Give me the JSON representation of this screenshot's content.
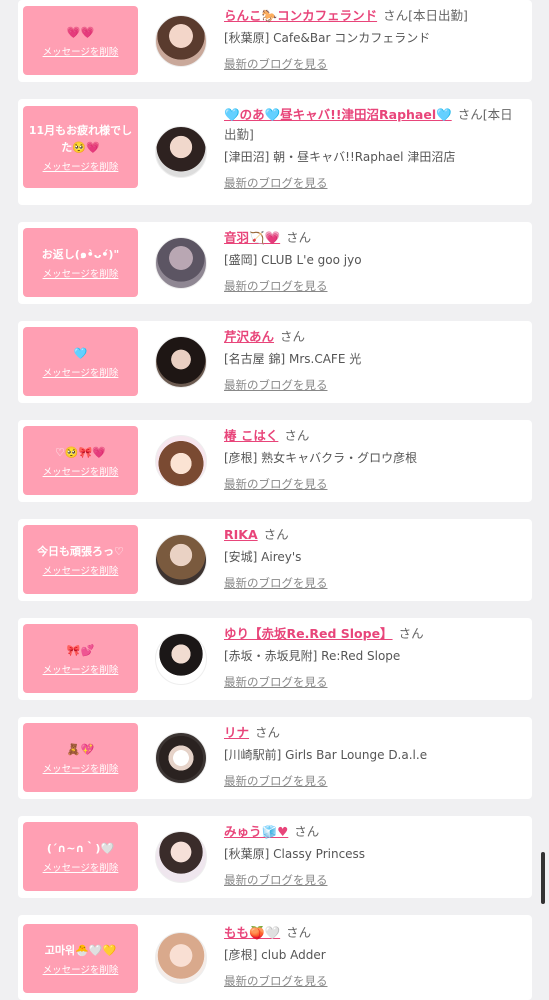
{
  "common": {
    "delete_label": "メッセージを削除",
    "blog_label": "最新のブログを見る"
  },
  "items": [
    {
      "message": "💗💗",
      "name": "らんこ🐎コンカフェランド",
      "suffix": "さん[本日出勤]",
      "shop": "[秋葉原] Cafe&Bar コンカフェランド"
    },
    {
      "message": "11月もお疲れ様でした🥺💗",
      "name": "🩵のあ🩵昼キャバ!!津田沼Raphael🩵",
      "suffix": "さん[本日出勤]",
      "shop": "[津田沼] 朝・昼キャバ!!Raphael 津田沼店"
    },
    {
      "message": "お返し(๑•̀ᴗ•́)\"",
      "name": "音羽🏹💗",
      "suffix": "さん",
      "shop": "[盛岡] CLUB L'e goo jyo"
    },
    {
      "message": "🩵",
      "name": "芹沢あん",
      "suffix": "さん",
      "shop": "[名古屋 錦] Mrs.CAFE 光"
    },
    {
      "message": "♡🥺🎀💗",
      "name": "椿 こはく",
      "suffix": "さん",
      "shop": "[彦根] 熟女キャバクラ・グロウ彦根"
    },
    {
      "message": "今日も頑張ろっ♡",
      "name": "RIKA",
      "suffix": "さん",
      "shop": "[安城] Airey's"
    },
    {
      "message": "🎀💕",
      "name": "ゆり【赤坂Re.Red Slope】",
      "suffix": "さん",
      "shop": "[赤坂・赤坂見附] Re:Red Slope"
    },
    {
      "message": "🧸💖",
      "name": "リナ",
      "suffix": "さん",
      "shop": "[川崎駅前] Girls Bar Lounge D.a.l.e"
    },
    {
      "message": "(´∩~∩｀)🤍",
      "name": "みゅう🧊♥",
      "suffix": "さん",
      "shop": "[秋葉原] Classy Princess"
    },
    {
      "message": "고마워🐣🤍💛",
      "name": "もも🍑🤍",
      "suffix": "さん",
      "shop": "[彦根] club Adder"
    }
  ]
}
